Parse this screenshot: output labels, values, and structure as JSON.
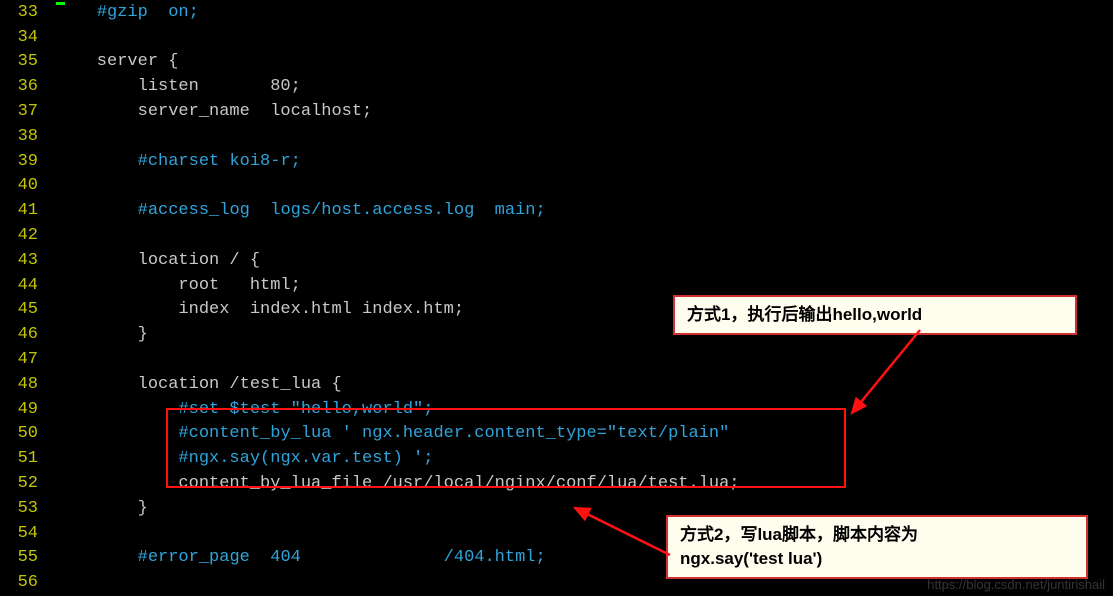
{
  "lines": [
    {
      "num": 33,
      "segments": [
        {
          "t": "    ",
          "c": ""
        },
        {
          "t": "#gzip  on;",
          "c": "comment"
        }
      ]
    },
    {
      "num": 34,
      "segments": [
        {
          "t": "",
          "c": ""
        }
      ]
    },
    {
      "num": 35,
      "segments": [
        {
          "t": "    server {",
          "c": ""
        }
      ]
    },
    {
      "num": 36,
      "segments": [
        {
          "t": "        listen       80;",
          "c": ""
        }
      ]
    },
    {
      "num": 37,
      "segments": [
        {
          "t": "        server_name  localhost;",
          "c": ""
        }
      ]
    },
    {
      "num": 38,
      "segments": [
        {
          "t": "",
          "c": ""
        }
      ]
    },
    {
      "num": 39,
      "segments": [
        {
          "t": "        ",
          "c": ""
        },
        {
          "t": "#charset koi8-r;",
          "c": "comment"
        }
      ]
    },
    {
      "num": 40,
      "segments": [
        {
          "t": "",
          "c": ""
        }
      ]
    },
    {
      "num": 41,
      "segments": [
        {
          "t": "        ",
          "c": ""
        },
        {
          "t": "#access_log  logs/host.access.log  main;",
          "c": "comment"
        }
      ]
    },
    {
      "num": 42,
      "segments": [
        {
          "t": "",
          "c": ""
        }
      ]
    },
    {
      "num": 43,
      "segments": [
        {
          "t": "        location / {",
          "c": ""
        }
      ]
    },
    {
      "num": 44,
      "segments": [
        {
          "t": "            root   html;",
          "c": ""
        }
      ]
    },
    {
      "num": 45,
      "segments": [
        {
          "t": "            index  index.html index.htm;",
          "c": ""
        }
      ]
    },
    {
      "num": 46,
      "segments": [
        {
          "t": "        }",
          "c": ""
        }
      ]
    },
    {
      "num": 47,
      "segments": [
        {
          "t": "",
          "c": ""
        }
      ]
    },
    {
      "num": 48,
      "segments": [
        {
          "t": "        location /test_lua {",
          "c": ""
        }
      ]
    },
    {
      "num": 49,
      "segments": [
        {
          "t": "            ",
          "c": ""
        },
        {
          "t": "#set $test \"hello,world\";",
          "c": "comment"
        }
      ]
    },
    {
      "num": 50,
      "segments": [
        {
          "t": "            ",
          "c": ""
        },
        {
          "t": "#content_by_lua ' ngx.header.content_type=\"text/plain\"",
          "c": "comment"
        }
      ]
    },
    {
      "num": 51,
      "segments": [
        {
          "t": "            ",
          "c": ""
        },
        {
          "t": "#ngx.say(ngx.var.test) ';",
          "c": "comment"
        }
      ]
    },
    {
      "num": 52,
      "segments": [
        {
          "t": "            content_by_lua_file /usr/local/nginx/conf/lua/test.lua;",
          "c": ""
        }
      ]
    },
    {
      "num": 53,
      "segments": [
        {
          "t": "        }",
          "c": ""
        }
      ]
    },
    {
      "num": 54,
      "segments": [
        {
          "t": "",
          "c": ""
        }
      ]
    },
    {
      "num": 55,
      "segments": [
        {
          "t": "        ",
          "c": ""
        },
        {
          "t": "#error_page  404              /404.html;",
          "c": "comment"
        }
      ]
    },
    {
      "num": 56,
      "segments": [
        {
          "t": "",
          "c": ""
        }
      ]
    }
  ],
  "callout1": "方式1，执行后输出hello,world",
  "callout2_line1": "方式2，写lua脚本，脚本内容为",
  "callout2_line2": "ngx.say('test lua')",
  "watermark": "https://blog.csdn.net/juntirishail"
}
